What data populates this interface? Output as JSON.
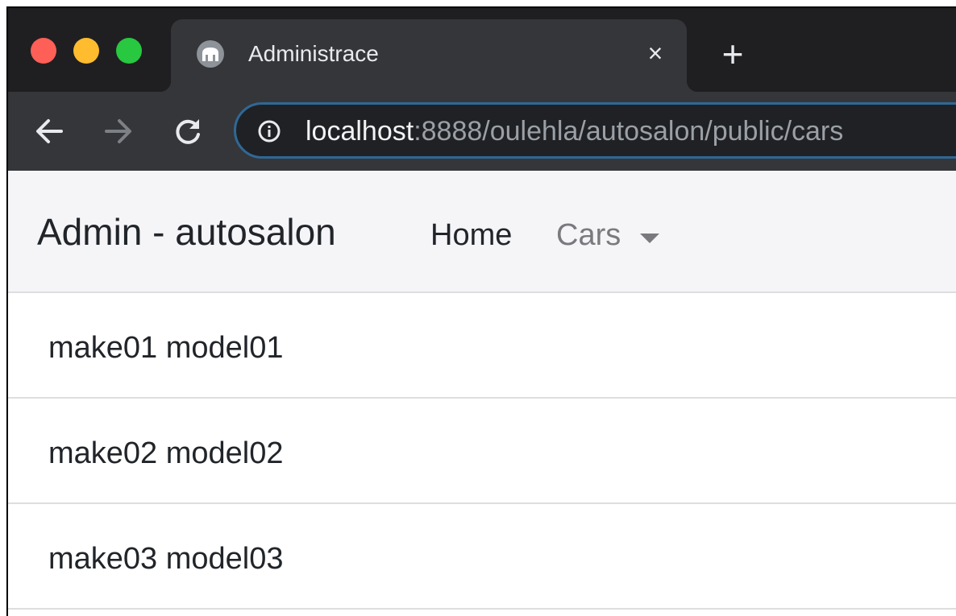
{
  "browser": {
    "tab": {
      "title": "Administrace",
      "close": "×",
      "favicon": "site-favicon"
    },
    "new_tab": "+",
    "toolbar": {
      "back_icon": "arrow-left-icon",
      "forward_icon": "arrow-right-icon",
      "reload_icon": "reload-icon",
      "info_icon": "info-icon"
    },
    "url": {
      "host": "localhost",
      "rest": ":8888/oulehla/autosalon/public/cars"
    },
    "traffic_lights": {
      "close_color": "#fe5f57",
      "minimize_color": "#febc2e",
      "zoom_color": "#28c840"
    }
  },
  "navbar": {
    "brand": "Admin - autosalon",
    "items": [
      {
        "label": "Home"
      },
      {
        "label": "Cars",
        "dropdown": true
      }
    ]
  },
  "cars": [
    {
      "label": "make01 model01"
    },
    {
      "label": "make02 model02"
    },
    {
      "label": "make03 model03"
    }
  ]
}
